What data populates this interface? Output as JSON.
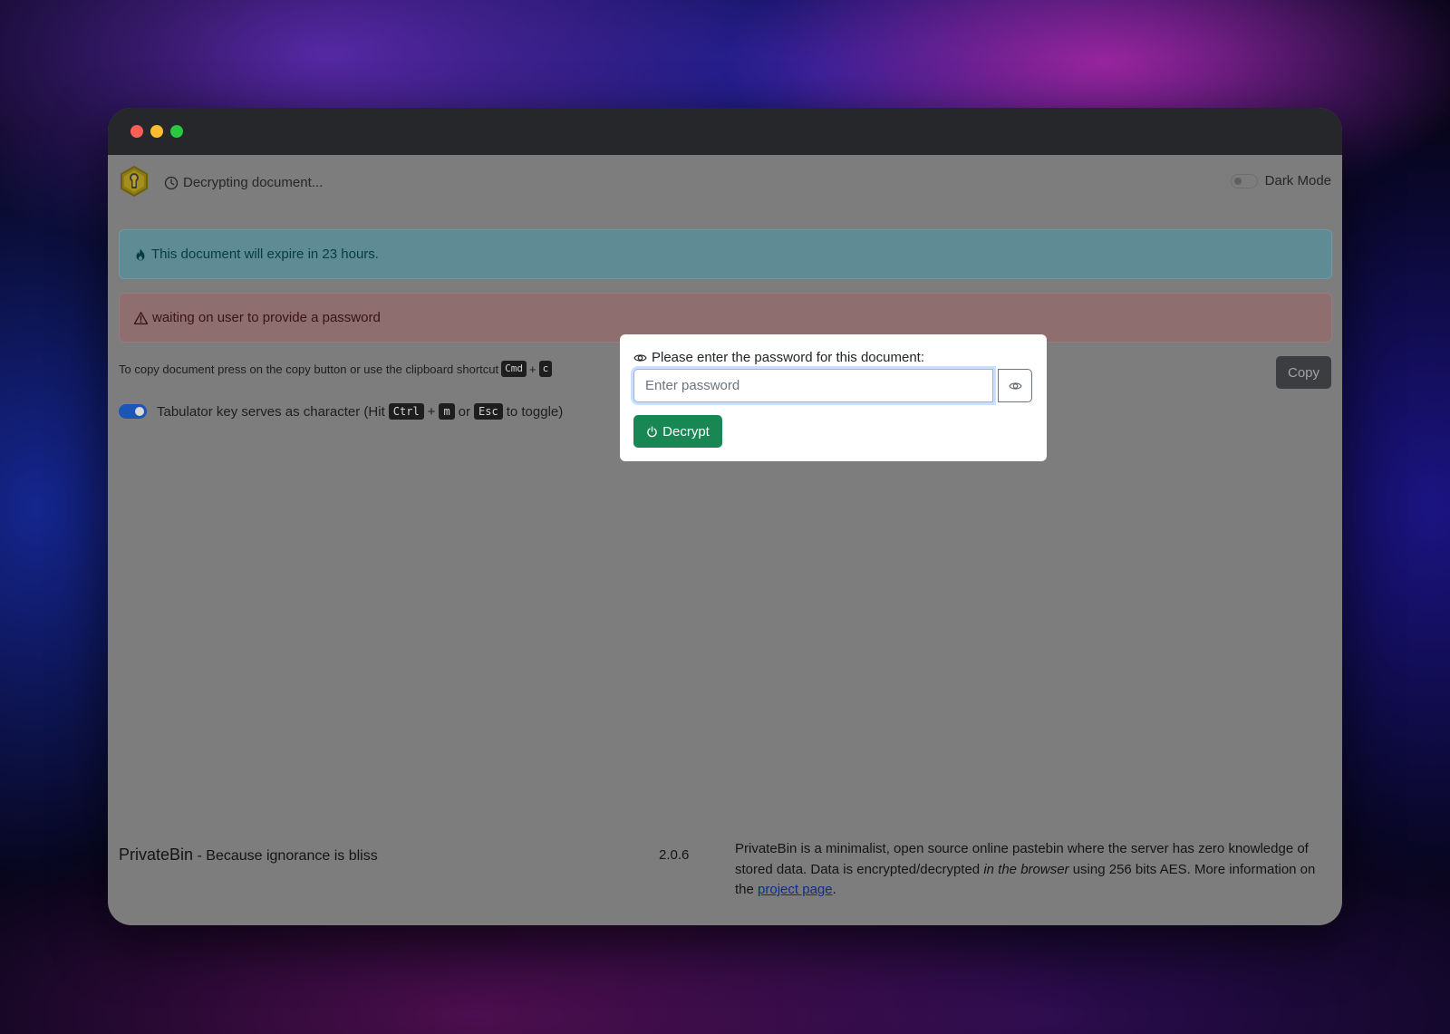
{
  "app": {
    "status_text": "Decrypting document...",
    "dark_mode_label": "Dark Mode",
    "dark_mode_enabled": false
  },
  "alerts": {
    "expiry": "This document will expire in 23 hours.",
    "password_wait": "waiting on user to provide a password"
  },
  "copy_hint": {
    "text": "To copy document press on the copy button or use the clipboard shortcut",
    "key1": "Cmd",
    "plus": "+",
    "key2": "c",
    "button_label": "Copy"
  },
  "tabulator": {
    "enabled": true,
    "text_before": "Tabulator key serves as character (Hit",
    "key1": "Ctrl",
    "plus": "+",
    "key2": "m",
    "or": "or",
    "key3": "Esc",
    "text_after": "to toggle)"
  },
  "footer": {
    "brand": "PrivateBin",
    "tagline": " - Because ignorance is bliss",
    "version": "2.0.6",
    "about_part1": "PrivateBin is a minimalist, open source online pastebin where the server has zero knowledge of stored data. Data is encrypted/decrypted ",
    "about_em": "in the browser",
    "about_part2": " using 256 bits AES. More information on the ",
    "about_link": "project page",
    "about_end": "."
  },
  "modal": {
    "label": "Please enter the password for this document:",
    "input_placeholder": "Enter password",
    "input_value": "",
    "decrypt_label": "Decrypt"
  },
  "colors": {
    "decrypt_button": "#198754",
    "toggle_on": "#1c55b8",
    "info_alert": "#5f8c94",
    "danger_alert": "#8f6e70"
  },
  "icons": {
    "logo": "privatebin-keyhole-logo",
    "status": "clock-icon",
    "expiry": "fire-icon",
    "warning": "warning-triangle-icon",
    "label": "eye-icon",
    "toggle_visibility": "eye-icon",
    "decrypt": "power-icon"
  }
}
